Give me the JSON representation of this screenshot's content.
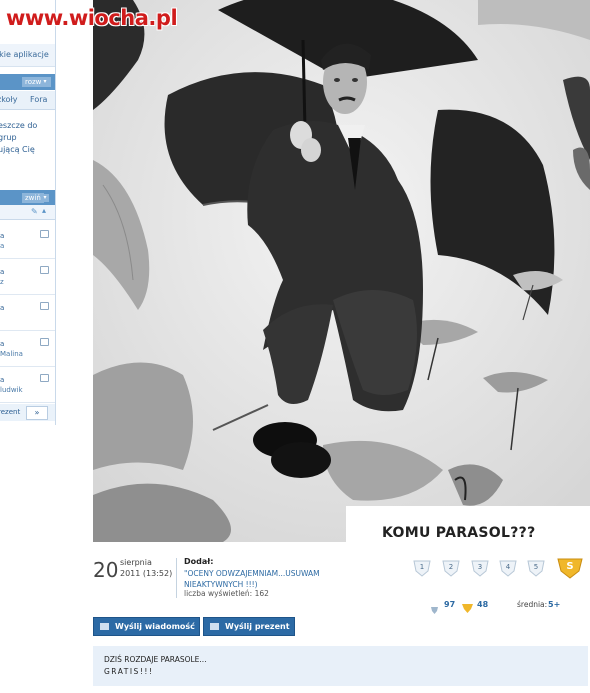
{
  "site": {
    "watermark": "www.wiocha.pl"
  },
  "sidebar": {
    "apps_link": "tkie aplikacje",
    "panel1": {
      "toggle": "rozwiń"
    },
    "tabs": [
      "zkoły",
      "Fora"
    ],
    "text_lines": [
      "eszcze do",
      "grup",
      "ującą Cię"
    ],
    "panel2": {
      "toggle": "zwiń"
    },
    "rows": [
      {
        "line1": "a",
        "line2": "a"
      },
      {
        "line1": "a",
        "line2": "z"
      },
      {
        "line1": "a",
        "line2": ""
      },
      {
        "line1": "a",
        "line2": "Malina"
      },
      {
        "line1": "a",
        "line2": "ludwik"
      }
    ],
    "footer": {
      "label": "rezent",
      "next": "»"
    }
  },
  "post": {
    "caption": "KOMU PARASOL???",
    "date": {
      "day": "20",
      "month": "sierpnia",
      "rest": "2011 (13:52)"
    },
    "dodal_label": "Dodał:",
    "author": "\"OCENY ODWZAJEMNIAM...USUWAM NIEAKTYWNYCH !!!)",
    "views": "liczba wyświetleń: 162",
    "ratings": [
      "1",
      "2",
      "3",
      "4",
      "5"
    ],
    "super_badge": "S",
    "stats": {
      "shield_count": "97",
      "star_count": "48",
      "avg_label": "średnia:",
      "avg_value": "5+"
    },
    "buttons": {
      "message": "Wyślij wiadomość",
      "gift": "Wyślij prezent"
    },
    "description": {
      "line1": "DZIŚ ROZDAJE PARASOLE...",
      "line2": "GRATIS!!!"
    }
  }
}
